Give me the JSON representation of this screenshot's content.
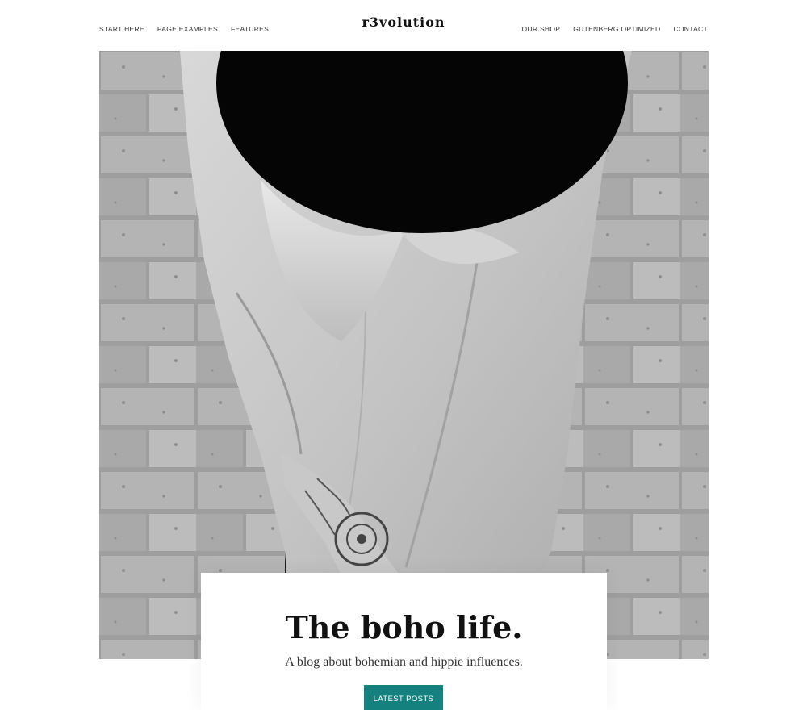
{
  "header": {
    "logo": "r3volution",
    "nav_left": [
      {
        "label": "START HERE"
      },
      {
        "label": "PAGE EXAMPLES"
      },
      {
        "label": "FEATURES"
      }
    ],
    "nav_right": [
      {
        "label": "OUR SHOP"
      },
      {
        "label": "GUTENBERG OPTIMIZED"
      },
      {
        "label": "CONTACT"
      }
    ]
  },
  "hero": {
    "title": "The boho life.",
    "subtitle": "A blog about bohemian and hippie influences.",
    "button_label": "LATEST POSTS"
  },
  "colors": {
    "accent": "#14817f",
    "background": "#ffffff",
    "text": "#111111"
  }
}
